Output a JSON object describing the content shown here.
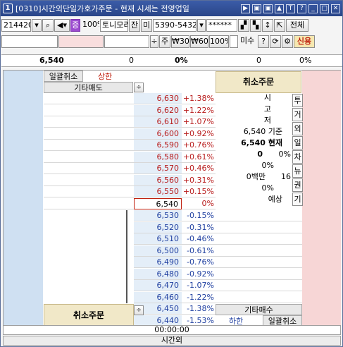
{
  "title": {
    "num": "1",
    "text": "[0310]시간외단일가호가주문 - 현재 시세는 전영업일",
    "icons": [
      "▶",
      "▣",
      "▣",
      "▲",
      "T",
      "?",
      "_",
      "□",
      "✕"
    ],
    "icon_names": [
      "play-icon",
      "restore-icon",
      "tile-icon",
      "up-icon",
      "font-icon",
      "help-icon",
      "minimize-icon",
      "maximize-icon",
      "close-icon"
    ]
  },
  "toolbar1": {
    "code": "214420",
    "stock_badge": "증",
    "margin": "100%",
    "name": "토니모리",
    "jan": "잔",
    "mi": "미",
    "account": "5390-5432",
    "password": "******",
    "all": "전체"
  },
  "toolbar2": {
    "ju": "주",
    "q30": "₩30",
    "q60": "₩60",
    "q100": "100%",
    "misu_label": "미수",
    "help": "?",
    "credit": "신용"
  },
  "summary": {
    "price": "6,540",
    "v1": "0",
    "pct": "0%",
    "v2": "0",
    "v3": "0%"
  },
  "labels": {
    "bulk_cancel": "일괄취소",
    "upper": "상한",
    "other_sell": "기타매도",
    "cancel_order": "취소주문",
    "other_buy": "기타매수",
    "lower": "하한",
    "cancel_order_bottom": "취소주문",
    "time": "00:00:00",
    "after_hours": "시간외"
  },
  "ask": [
    {
      "price": "6,630",
      "rate": "+1.38%"
    },
    {
      "price": "6,620",
      "rate": "+1.22%"
    },
    {
      "price": "6,610",
      "rate": "+1.07%"
    },
    {
      "price": "6,600",
      "rate": "+0.92%"
    },
    {
      "price": "6,590",
      "rate": "+0.76%"
    },
    {
      "price": "6,580",
      "rate": "+0.61%"
    },
    {
      "price": "6,570",
      "rate": "+0.46%"
    },
    {
      "price": "6,560",
      "rate": "+0.31%"
    },
    {
      "price": "6,550",
      "rate": "+0.15%"
    },
    {
      "price": "6,540",
      "rate": "0%"
    }
  ],
  "bid": [
    {
      "price": "6,530",
      "rate": "-0.15%"
    },
    {
      "price": "6,520",
      "rate": "-0.31%"
    },
    {
      "price": "6,510",
      "rate": "-0.46%"
    },
    {
      "price": "6,500",
      "rate": "-0.61%"
    },
    {
      "price": "6,490",
      "rate": "-0.76%"
    },
    {
      "price": "6,480",
      "rate": "-0.92%"
    },
    {
      "price": "6,470",
      "rate": "-1.07%"
    },
    {
      "price": "6,460",
      "rate": "-1.22%"
    },
    {
      "price": "6,450",
      "rate": "-1.38%"
    },
    {
      "price": "6,440",
      "rate": "-1.53%"
    }
  ],
  "info": {
    "open": "시",
    "high": "고",
    "low": "저",
    "base": "6,540 기준",
    "current": "6,540 현재",
    "cur_vol": "0",
    "cur_pct": "0%",
    "pct2": "0%",
    "amount": "0백만",
    "amount_n": "16",
    "pct3": "0%",
    "expect": "예상"
  },
  "vtabs": [
    "투",
    "거",
    "외",
    "일",
    "차",
    "뉴",
    "권",
    "기"
  ],
  "colors": {
    "title": "#2f4d95",
    "ask_text": "#b81b1b",
    "bid_text": "#1f3fa0",
    "cancel_bg": "#f1e8c8",
    "left_col": "#cfe0f2",
    "right_col": "#f7d6d6"
  }
}
